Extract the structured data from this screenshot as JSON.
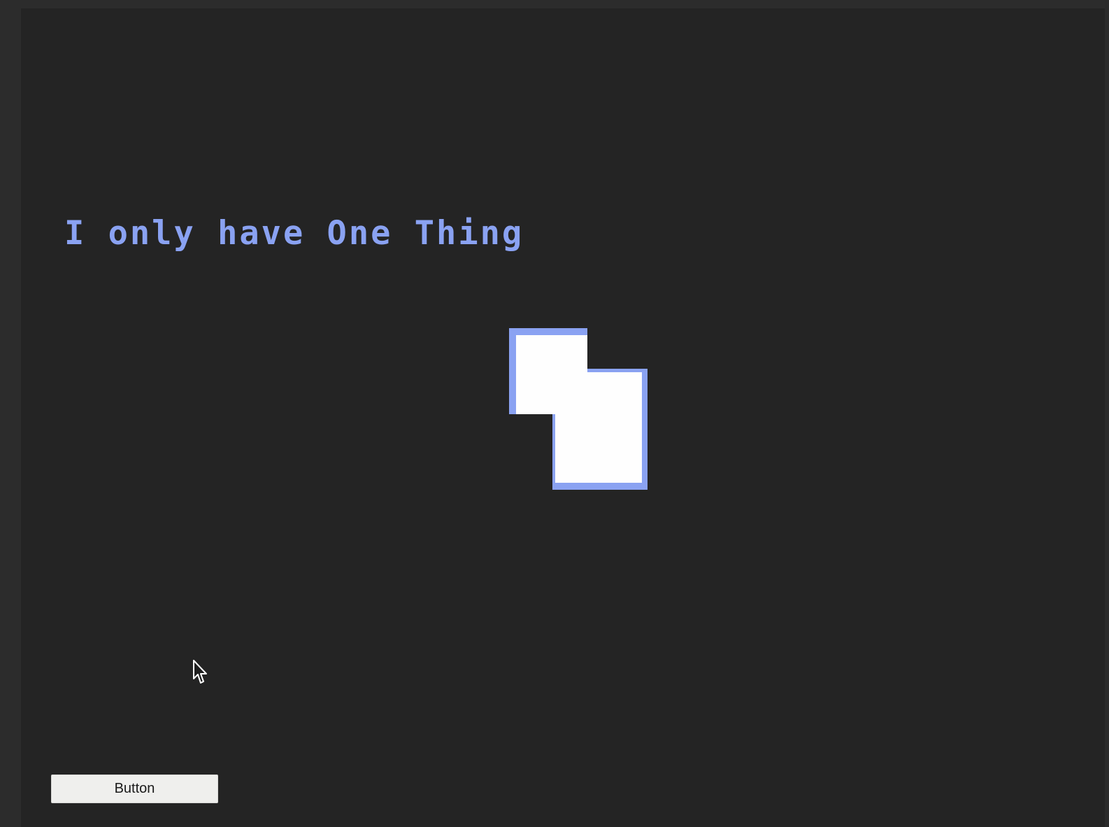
{
  "heading": {
    "text": "I only have One Thing"
  },
  "button": {
    "label": "Button"
  },
  "colors": {
    "background": "#242424",
    "accent": "#8aa2f2",
    "piece_fill": "#fefefe",
    "button_bg": "#efefed",
    "button_text": "#1a1a1a"
  },
  "icons": {
    "cursor": "mouse-pointer-icon",
    "piece": "block-piece"
  }
}
